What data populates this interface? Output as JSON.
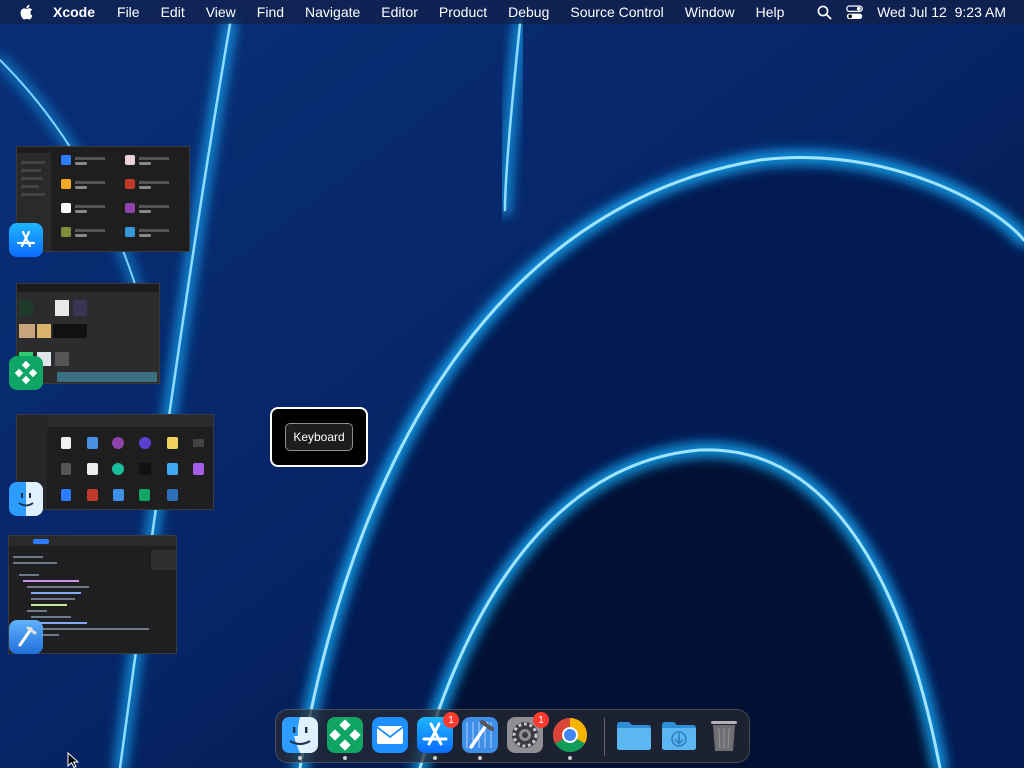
{
  "menubar": {
    "app_name": "Xcode",
    "menus": [
      "File",
      "Edit",
      "View",
      "Find",
      "Navigate",
      "Editor",
      "Product",
      "Debug",
      "Source Control",
      "Window",
      "Help"
    ],
    "clock": "Wed Jul 12  9:23 AM"
  },
  "tooltip": {
    "label": "Keyboard"
  },
  "switcher": {
    "windows": [
      {
        "app": "App Store",
        "icon": "app-store-icon"
      },
      {
        "app": "Mosaic",
        "icon": "mosaic-icon"
      },
      {
        "app": "Finder",
        "icon": "finder-icon"
      },
      {
        "app": "Xcode",
        "icon": "xcode-icon"
      }
    ]
  },
  "dock": {
    "items": [
      {
        "name": "Finder",
        "icon": "finder-icon",
        "running": true
      },
      {
        "name": "Mosaic",
        "icon": "mosaic-icon",
        "running": true
      },
      {
        "name": "Mail",
        "icon": "mail-icon",
        "running": false
      },
      {
        "name": "App Store",
        "icon": "app-store-icon",
        "running": true,
        "badge": "1"
      },
      {
        "name": "Xcode",
        "icon": "xcode-icon",
        "running": true
      },
      {
        "name": "System Settings",
        "icon": "gear-icon",
        "running": false,
        "badge": "1"
      },
      {
        "name": "Google Chrome",
        "icon": "chrome-icon",
        "running": true
      },
      {
        "name": "Applications Folder",
        "icon": "folder-icon",
        "running": false
      },
      {
        "name": "Downloads",
        "icon": "downloads-folder-icon",
        "running": false
      },
      {
        "name": "Trash",
        "icon": "trash-icon",
        "running": false
      }
    ]
  },
  "colors": {
    "wallpaper_glow": "#00a8ff",
    "wallpaper_dark": "#021033",
    "badge": "#ff3b30"
  }
}
